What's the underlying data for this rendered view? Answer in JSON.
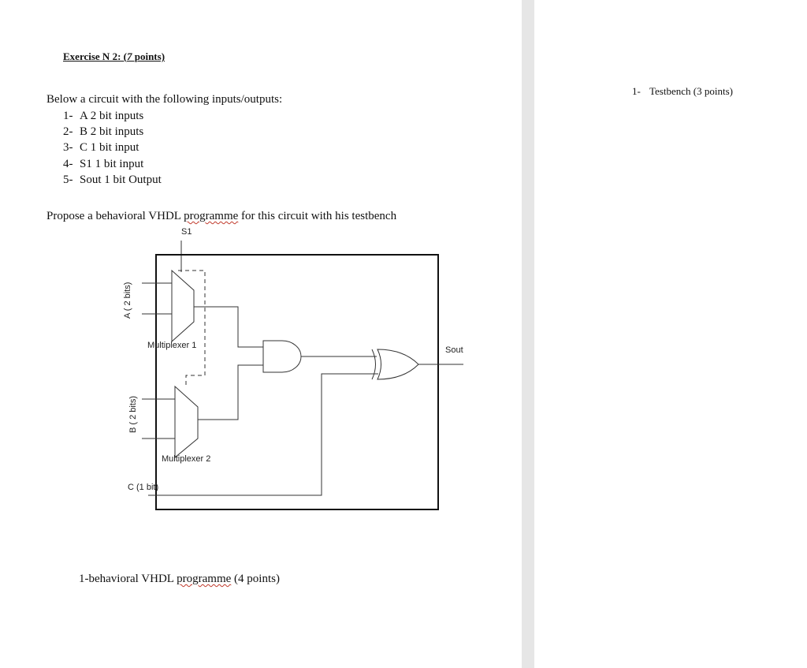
{
  "document": {
    "title_prefix": "Exercise N 2: (",
    "title_points_num": "7",
    "title_suffix": " points)",
    "intro": "Below a circuit with the following inputs/outputs:",
    "io_items": [
      {
        "marker": "1-",
        "text": "A 2 bit inputs"
      },
      {
        "marker": "2-",
        "text": "B 2 bit inputs"
      },
      {
        "marker": "3-",
        "text": "C 1 bit input"
      },
      {
        "marker": "4-",
        "text": "S1 1 bit input"
      },
      {
        "marker": "5-",
        "text": "Sout 1 bit Output"
      }
    ],
    "propose_before": "Propose a behavioral VHDL ",
    "propose_word": "programme",
    "propose_after": " for this circuit with his testbench",
    "behavioral_before": "1-behavioral VHDL ",
    "behavioral_word": "programme",
    "behavioral_after": " (4 points)",
    "testbench_marker": "1-",
    "testbench_text": "Testbench (3 points)"
  },
  "circuit": {
    "label_s1": "S1",
    "label_a": "A ( 2 bits)",
    "label_b": "B ( 2 bits)",
    "label_mux1": "Multiplexer 1",
    "label_mux2": "Multiplexer 2",
    "label_c": "C (1 bit)",
    "label_sout": "Sout"
  }
}
